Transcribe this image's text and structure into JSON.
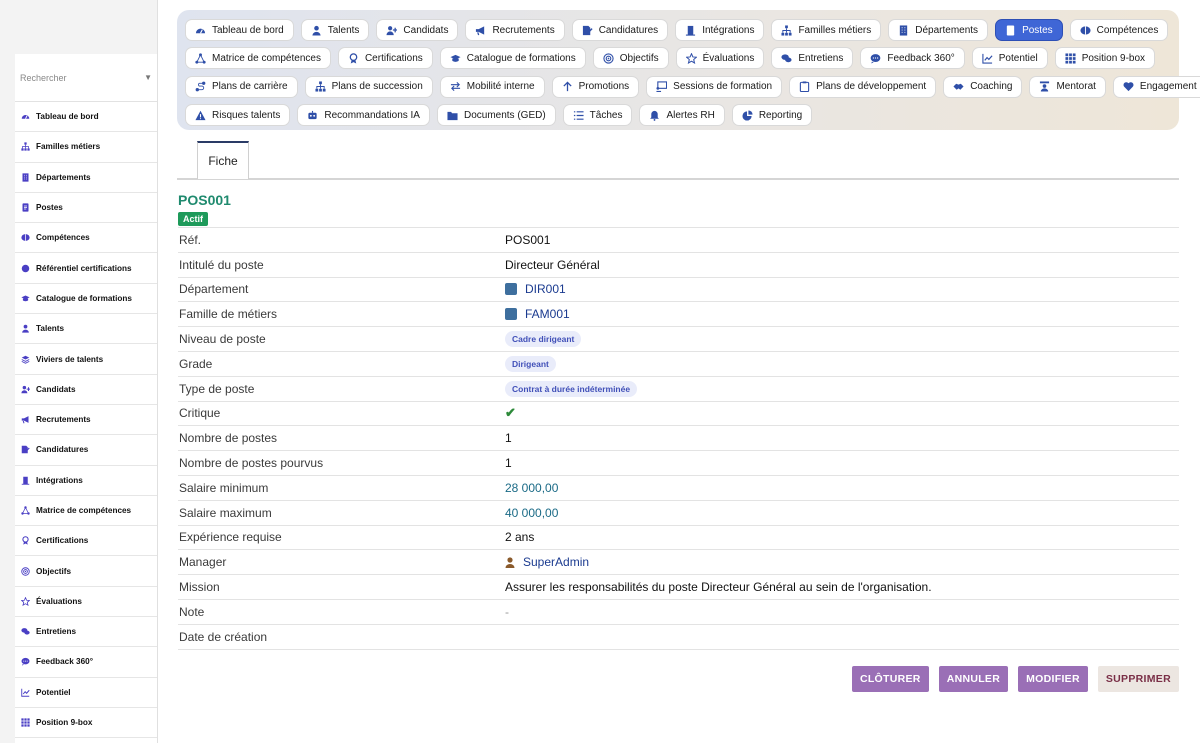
{
  "sidebar": {
    "search_placeholder": "Rechercher",
    "items": [
      {
        "label": "Tableau de bord",
        "icon": "gauge-icon"
      },
      {
        "label": "Familles métiers",
        "icon": "sitemap-icon"
      },
      {
        "label": "Départements",
        "icon": "building-icon"
      },
      {
        "label": "Postes",
        "icon": "id-badge-icon"
      },
      {
        "label": "Compétences",
        "icon": "brain-icon"
      },
      {
        "label": "Référentiel certifications",
        "icon": "circle-icon"
      },
      {
        "label": "Catalogue de formations",
        "icon": "graduation-cap-icon"
      },
      {
        "label": "Talents",
        "icon": "user-icon"
      },
      {
        "label": "Viviers de talents",
        "icon": "layers-icon"
      },
      {
        "label": "Candidats",
        "icon": "user-plus-icon"
      },
      {
        "label": "Recrutements",
        "icon": "megaphone-icon"
      },
      {
        "label": "Candidatures",
        "icon": "file-signature-icon"
      },
      {
        "label": "Intégrations",
        "icon": "door-icon"
      },
      {
        "label": "Matrice de compétences",
        "icon": "network-icon"
      },
      {
        "label": "Certifications",
        "icon": "award-icon"
      },
      {
        "label": "Objectifs",
        "icon": "target-icon"
      },
      {
        "label": "Évaluations",
        "icon": "star-icon"
      },
      {
        "label": "Entretiens",
        "icon": "comments-icon"
      },
      {
        "label": "Feedback 360°",
        "icon": "comment-dots-icon"
      },
      {
        "label": "Potentiel",
        "icon": "chart-line-icon"
      },
      {
        "label": "Position 9-box",
        "icon": "grid-icon"
      }
    ]
  },
  "topnav": {
    "rows": [
      [
        {
          "label": "Tableau de bord",
          "icon": "gauge-icon"
        },
        {
          "label": "Talents",
          "icon": "user-icon"
        },
        {
          "label": "Candidats",
          "icon": "user-plus-icon"
        },
        {
          "label": "Recrutements",
          "icon": "megaphone-icon"
        },
        {
          "label": "Candidatures",
          "icon": "file-signature-icon"
        },
        {
          "label": "Intégrations",
          "icon": "door-icon"
        },
        {
          "label": "Familles métiers",
          "icon": "sitemap-icon"
        },
        {
          "label": "Départements",
          "icon": "building-icon"
        },
        {
          "label": "Postes",
          "icon": "id-badge-icon",
          "active": true
        },
        {
          "label": "Compétences",
          "icon": "brain-icon"
        }
      ],
      [
        {
          "label": "Matrice de compétences",
          "icon": "network-icon"
        },
        {
          "label": "Certifications",
          "icon": "award-icon"
        },
        {
          "label": "Catalogue de formations",
          "icon": "graduation-cap-icon"
        },
        {
          "label": "Objectifs",
          "icon": "target-icon"
        },
        {
          "label": "Évaluations",
          "icon": "star-icon"
        },
        {
          "label": "Entretiens",
          "icon": "comments-icon"
        },
        {
          "label": "Feedback 360°",
          "icon": "comment-dots-icon"
        },
        {
          "label": "Potentiel",
          "icon": "chart-line-icon"
        },
        {
          "label": "Position 9-box",
          "icon": "grid-icon"
        }
      ],
      [
        {
          "label": "Plans de carrière",
          "icon": "route-icon"
        },
        {
          "label": "Plans de succession",
          "icon": "sitemap-icon"
        },
        {
          "label": "Mobilité interne",
          "icon": "arrows-icon"
        },
        {
          "label": "Promotions",
          "icon": "arrow-up-icon"
        },
        {
          "label": "Sessions de formation",
          "icon": "chalkboard-icon"
        },
        {
          "label": "Plans de développement",
          "icon": "clipboard-icon"
        },
        {
          "label": "Coaching",
          "icon": "handshake-icon"
        },
        {
          "label": "Mentorat",
          "icon": "mentor-icon"
        },
        {
          "label": "Engagement",
          "icon": "heart-icon"
        }
      ],
      [
        {
          "label": "Risques talents",
          "icon": "warning-icon"
        },
        {
          "label": "Recommandations IA",
          "icon": "robot-icon"
        },
        {
          "label": "Documents (GED)",
          "icon": "folder-icon"
        },
        {
          "label": "Tâches",
          "icon": "tasks-icon"
        },
        {
          "label": "Alertes RH",
          "icon": "bell-icon"
        },
        {
          "label": "Reporting",
          "icon": "pie-chart-icon"
        }
      ]
    ]
  },
  "tab": {
    "label": "Fiche"
  },
  "record": {
    "title": "POS001",
    "status": "Actif",
    "fields": [
      {
        "label": "Réf.",
        "value": "POS001",
        "kind": "text"
      },
      {
        "label": "Intitulé du poste",
        "value": "Directeur Général",
        "kind": "text"
      },
      {
        "label": "Département",
        "value": "DIR001",
        "kind": "link"
      },
      {
        "label": "Famille de métiers",
        "value": "FAM001",
        "kind": "link"
      },
      {
        "label": "Niveau de poste",
        "value": "Cadre dirigeant",
        "kind": "badge"
      },
      {
        "label": "Grade",
        "value": "Dirigeant",
        "kind": "badge"
      },
      {
        "label": "Type de poste",
        "value": "Contrat à durée indéterminée",
        "kind": "badge"
      },
      {
        "label": "Critique",
        "value": "✔",
        "kind": "check"
      },
      {
        "label": "Nombre de postes",
        "value": "1",
        "kind": "text"
      },
      {
        "label": "Nombre de postes pourvus",
        "value": "1",
        "kind": "text"
      },
      {
        "label": "Salaire minimum",
        "value": "28 000,00",
        "kind": "money"
      },
      {
        "label": "Salaire maximum",
        "value": "40 000,00",
        "kind": "money"
      },
      {
        "label": "Expérience requise",
        "value": "2 ans",
        "kind": "text"
      },
      {
        "label": "Manager",
        "value": "SuperAdmin",
        "kind": "user"
      },
      {
        "label": "Mission",
        "value": "Assurer les responsabilités du poste Directeur Général au sein de l'organisation.",
        "kind": "text"
      },
      {
        "label": "Note",
        "value": "-",
        "kind": "dash"
      },
      {
        "label": "Date de création",
        "value": "",
        "kind": "text"
      }
    ]
  },
  "actions": {
    "close": "CLÔTURER",
    "cancel": "ANNULER",
    "edit": "MODIFIER",
    "delete": "SUPPRIMER"
  },
  "colors": {
    "accent": "#3f66d6",
    "title": "#1f8a6e",
    "status": "#1e9a5a",
    "button": "#9a6fb6"
  }
}
